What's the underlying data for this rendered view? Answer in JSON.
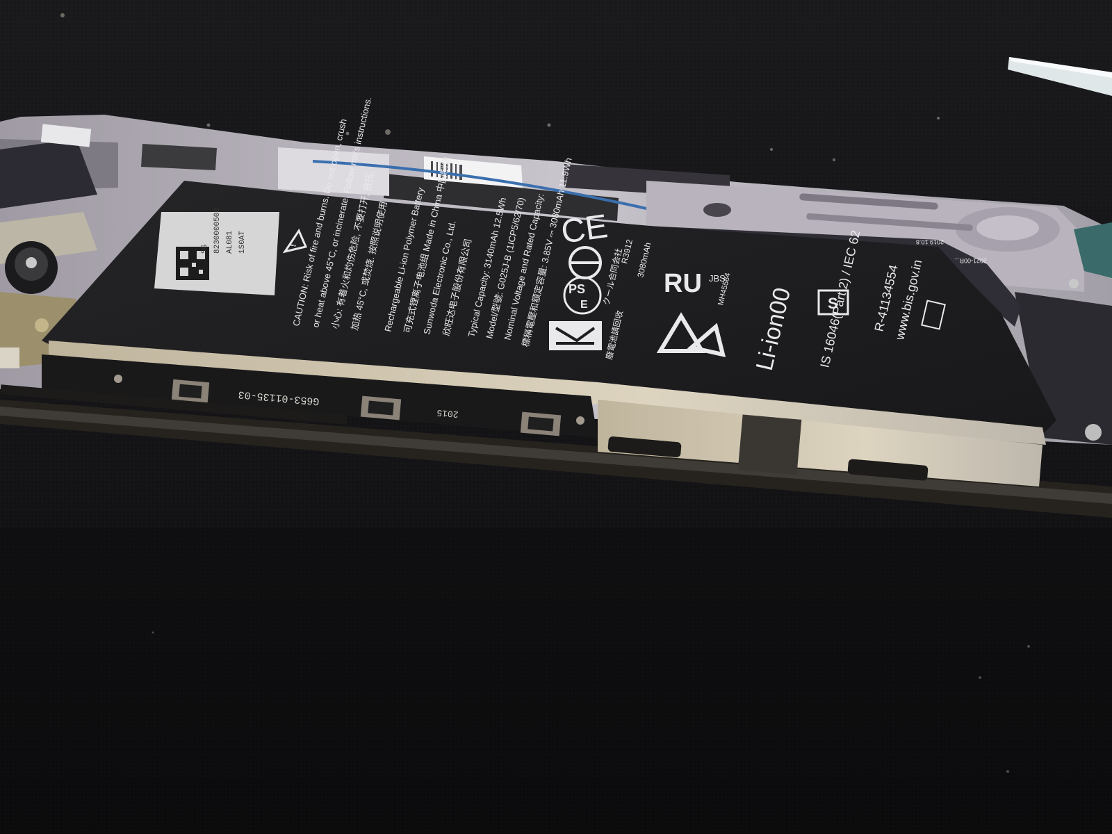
{
  "battery": {
    "label_code_1": "SG",
    "label_code_2": "8230000500",
    "label_code_3": "AL081",
    "label_code_4": "1S0AT",
    "caution_line_1": "CAUTION: Risk of fire and burns. Do not open, crush",
    "caution_line_2": "or heat above 45°C, or incinerate. Follow mfr's instructions.",
    "cn_line_1": "小心: 有着火和灼伤危险, 不要打开, 挤压,",
    "cn_line_2": "加热 45°C, 或焚烧. 按照说明使用",
    "type_line": "Rechargeable Li-ion Polymer Battery",
    "made_line": "Made in China 中国制造",
    "cn_line_3": "可充式锂离子电池组 Made in China 中国制造",
    "maker_line": "Sunwoda Electronic Co., Ltd.",
    "maker_cn": "欣旺达电子股份有限公司",
    "capacity_line": "Typical Capacity: 3140mAh 12.5Wh",
    "model_line": "Model/型號: G025J-B (1ICP5/62/70)",
    "nominal_line": "Nominal Voltage and Rated Capacity:",
    "rated_line": "標稱電壓和額定容量: 3.85V ⎓ 3080mAh 11.9Wh",
    "recycle_cn": "廢電池請回收",
    "recycle_jp": "クール合同会社",
    "code_r": "R3912",
    "mah": "3080mAh",
    "ce_mark": "CE",
    "pse_top": "PS",
    "pse_bottom": "E",
    "ul_mark": "RU",
    "jbs": "JBS",
    "mh_code": "MH45584",
    "li_ion": "Li-ion00",
    "standard": "IS 16046(Part 2) / IEC 62",
    "bis_r": "R-41134554",
    "bis_url": "www.bis.gov.in",
    "flex_text_1": "2019.10.8",
    "flex_text_2": "2021-00R..."
  },
  "pcb": {
    "part_number": "G653-01135-03",
    "date_code": "2015"
  },
  "colors": {
    "background": "#121214",
    "battery": "#1e1e20",
    "frame": "#c7c5c6",
    "gold": "#d6ccb6",
    "white_text": "#e9e9ec"
  }
}
